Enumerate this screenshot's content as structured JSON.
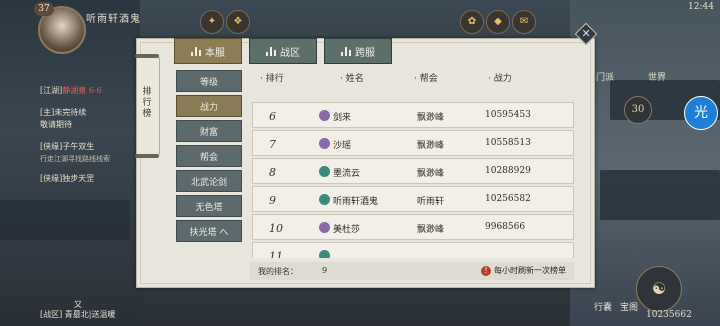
{
  "player": {
    "level": "37",
    "name": "听雨轩酒鬼"
  },
  "quests": [
    {
      "tag": "[江湖]",
      "text": "静湖泉 6-6",
      "color": "#e06060"
    },
    {
      "tag": "[主]",
      "text": "未完待续",
      "color": "#e8e0cc"
    },
    {
      "tag": "",
      "text": "敬请期待",
      "color": "#e8e0cc"
    },
    {
      "tag": "[侠缘]",
      "text": "子午双生",
      "color": "#e8e0cc"
    },
    {
      "tag": "",
      "text": "行走江湖寻找路线线索",
      "color": "#c8c0b0"
    },
    {
      "tag": "[侠缘]",
      "text": "独步天罡",
      "color": "#e8e0cc"
    }
  ],
  "chat": {
    "user": "又",
    "line": "[战区] 青墓北|送温暖"
  },
  "top_tabs": [
    {
      "label": "本服",
      "active": true
    },
    {
      "label": "战区",
      "active": false
    },
    {
      "label": "跨服",
      "active": false
    }
  ],
  "scroll_title": "排行榜",
  "categories": [
    {
      "label": "等级",
      "active": false
    },
    {
      "label": "战力",
      "active": true
    },
    {
      "label": "财富",
      "active": false
    },
    {
      "label": "帮会",
      "active": false
    },
    {
      "label": "北武论剑",
      "active": false
    },
    {
      "label": "无色塔",
      "active": false
    },
    {
      "label": "扶光塔 へ",
      "active": false
    }
  ],
  "table": {
    "headers": [
      "· 排行",
      "· 姓名",
      "· 帮会",
      "· 战力"
    ],
    "rows": [
      {
        "rank": "6",
        "name": "剑来",
        "guild": "飘渺峰",
        "power": "10595453",
        "emblem": "#8a6aa8"
      },
      {
        "rank": "7",
        "name": "沙瑶",
        "guild": "飘渺峰",
        "power": "10558513",
        "emblem": "#8a6aa8"
      },
      {
        "rank": "8",
        "name": "墨流云",
        "guild": "飘渺峰",
        "power": "10288929",
        "emblem": "#3a8a7a"
      },
      {
        "rank": "9",
        "name": "听雨轩酒鬼",
        "guild": "听雨轩",
        "power": "10256582",
        "emblem": "#3a8a7a"
      },
      {
        "rank": "10",
        "name": "美杜莎",
        "guild": "飘渺峰",
        "power": "9968566",
        "emblem": "#8a6aa8"
      },
      {
        "rank": "11",
        "name": "",
        "guild": "",
        "power": "",
        "emblem": "#3a8a7a"
      }
    ]
  },
  "footer": {
    "my_rank_label": "我的排名：",
    "my_rank_value": "9",
    "notice": "每小时刷新一次榜单"
  },
  "right_hud": {
    "time": "12:44",
    "clan": "门派",
    "world": "世界",
    "icon_num": "30",
    "bottom_num": "10235662",
    "treasure": "宝阁",
    "action": "行囊"
  }
}
